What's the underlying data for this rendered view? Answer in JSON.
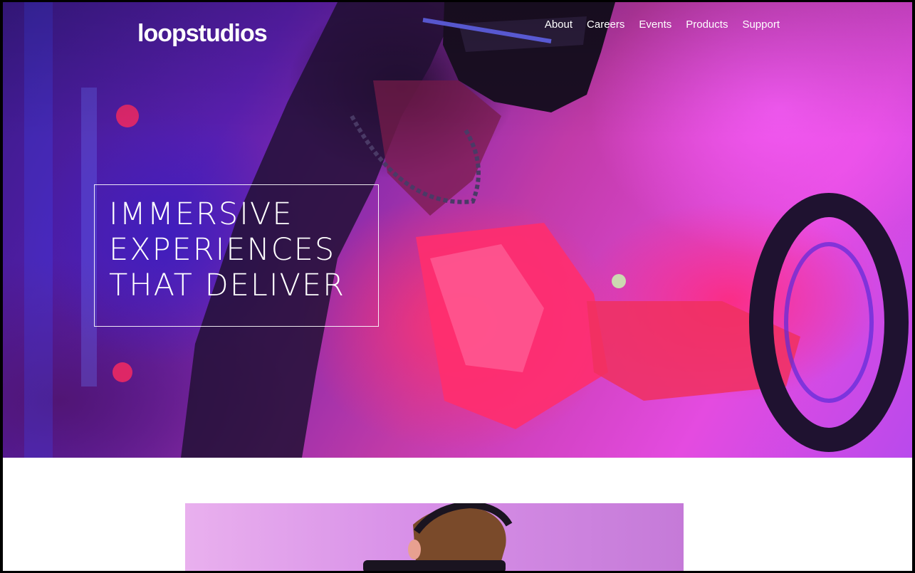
{
  "header": {
    "logo": "loopstudios",
    "nav": [
      {
        "label": "About"
      },
      {
        "label": "Careers"
      },
      {
        "label": "Events"
      },
      {
        "label": "Products"
      },
      {
        "label": "Support"
      }
    ]
  },
  "hero": {
    "headline_lines": [
      "IMMERSIVE",
      "EXPERIENCES",
      "THAT DELIVER"
    ]
  },
  "colors": {
    "text_light": "#ffffff",
    "hero_magenta": "#e44be0",
    "hero_blue": "#3a1a8a",
    "hero_red": "#ff3270",
    "intro_image_lilac": "#d890e8"
  }
}
